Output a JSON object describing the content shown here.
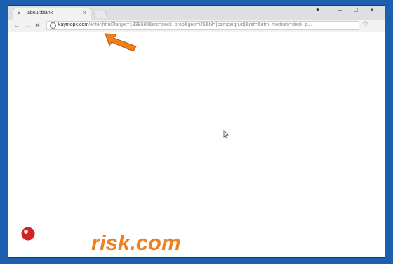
{
  "browser": {
    "tab": {
      "title": "about:blank"
    },
    "window_controls": {
      "minimize": "–",
      "maximize": "□",
      "close": "✕"
    },
    "nav": {
      "back": "←",
      "forward": "→",
      "reload": "✕"
    },
    "address_bar": {
      "domain": "kaymopk.com",
      "path": "/enter.html?target=1339680&src=desk_prop&geo=US&t3={campaign.id}&ref=&utm_medium=desk_p..."
    },
    "icons": {
      "tab_favicon": "page-icon",
      "info": "info-icon",
      "bookmark": "star-icon",
      "menu": "kebab-menu-icon",
      "profile": "account-icon"
    }
  },
  "overlay": {
    "arrow_color": "#f07f1e"
  },
  "watermark": {
    "text": "PCrisk.com",
    "colors": {
      "pc": "#ffffff",
      "risk": "#f07f1e",
      "magnifier": "#d32323"
    }
  }
}
